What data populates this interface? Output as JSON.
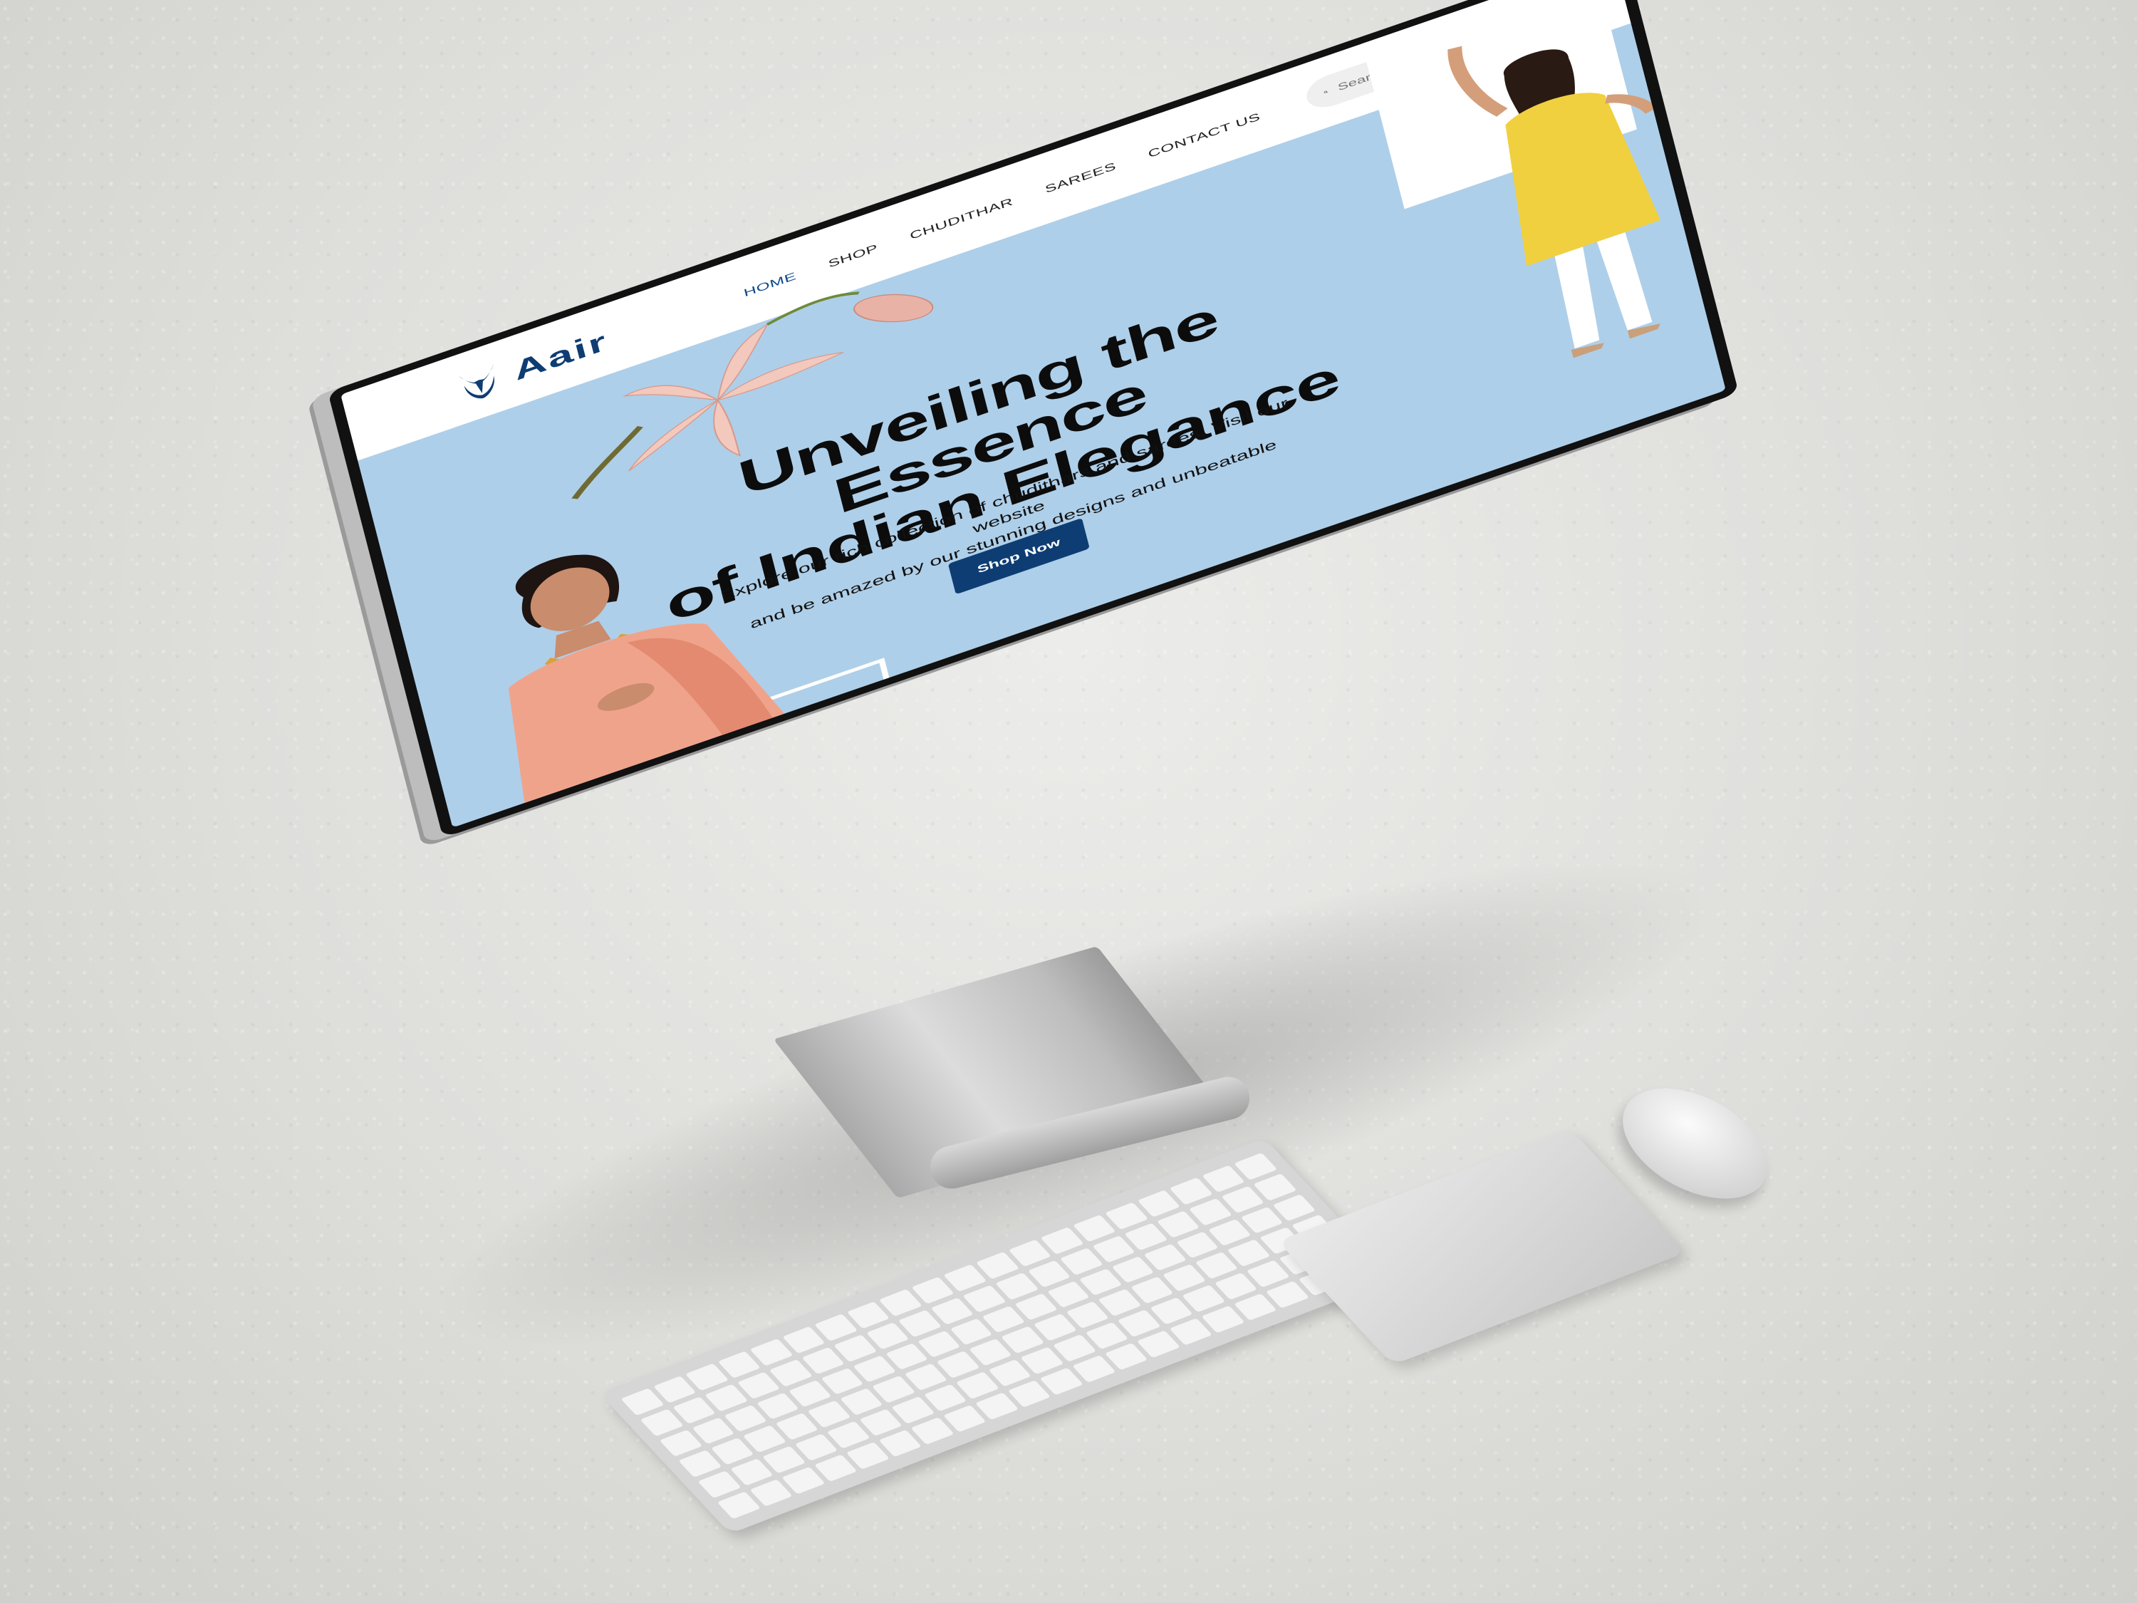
{
  "site": {
    "brand": "Aair",
    "nav": [
      {
        "label": "HOME",
        "active": true
      },
      {
        "label": "SHOP",
        "active": false
      },
      {
        "label": "CHUDITHAR",
        "active": false
      },
      {
        "label": "SAREES",
        "active": false
      },
      {
        "label": "CONTACT US",
        "active": false
      }
    ],
    "search_placeholder": "Search for produc",
    "icons": [
      "user-icon",
      "heart-icon",
      "basket-icon"
    ]
  },
  "hero": {
    "title_line1": "Unveiling the Essence",
    "title_line2": "of Indian Elegance",
    "subtitle_line1": "Explore our rich collection of chudithars and sarees. Visit our website",
    "subtitle_line2": "and be amazed by our stunning designs and unbeatable prices!",
    "cta": "Shop Now"
  },
  "colors": {
    "brand_navy": "#0d3d73",
    "hero_bg": "#aecfe9",
    "header_bg": "#ffffff"
  }
}
